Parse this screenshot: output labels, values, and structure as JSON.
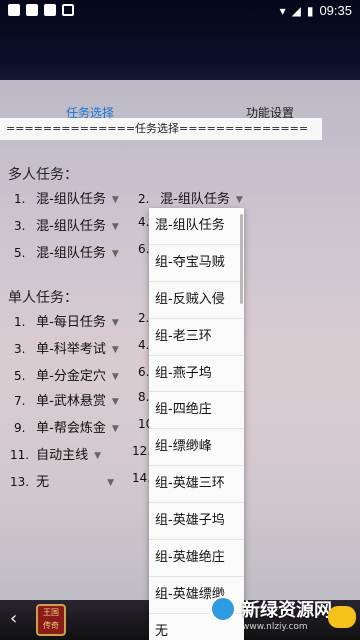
{
  "status_bar": {
    "time": "09:35",
    "left_icons": [
      "photo-icon",
      "square-icon",
      "square-icon",
      "apps-icon"
    ],
    "right_icons": [
      "wifi-icon",
      "signal-icon",
      "battery-icon"
    ]
  },
  "tabs": [
    "任务选择",
    "功能设置"
  ],
  "section_title": "==============任务选择==============",
  "multi": {
    "heading": "多人任务：",
    "rows": [
      {
        "num": "1.",
        "value": "混-组队任务"
      },
      {
        "num": "2.",
        "value": "混-组队任务"
      },
      {
        "num": "3.",
        "value": "混-组队任务"
      },
      {
        "num": "4.",
        "value": ""
      },
      {
        "num": "5.",
        "value": "混-组队任务"
      },
      {
        "num": "6.",
        "value": ""
      }
    ]
  },
  "single": {
    "heading": "单人任务：",
    "rows": [
      {
        "num": "1.",
        "value": "单-每日任务"
      },
      {
        "num": "2.",
        "value": ""
      },
      {
        "num": "3.",
        "value": "单-科举考试"
      },
      {
        "num": "4.",
        "value": ""
      },
      {
        "num": "5.",
        "value": "单-分金定穴"
      },
      {
        "num": "6.",
        "value": ""
      },
      {
        "num": "7.",
        "value": "单-武林悬赏"
      },
      {
        "num": "8.",
        "value": ""
      },
      {
        "num": "9.",
        "value": "单-帮会炼金"
      },
      {
        "num": "10.",
        "value": ""
      },
      {
        "num": "11.",
        "value": "自动主线"
      },
      {
        "num": "12.",
        "value": ""
      },
      {
        "num": "13.",
        "value": "无"
      },
      {
        "num": "14.",
        "value": ""
      }
    ]
  },
  "dropdown": {
    "options": [
      "混-组队任务",
      "组-夺宝马贼",
      "组-反贼入侵",
      "组-老三环",
      "组-燕子坞",
      "组-四绝庄",
      "组-缥缈峰",
      "组-英雄三环",
      "组-英雄子坞",
      "组-英雄绝庄",
      "组-英雄缥缈",
      "无"
    ]
  },
  "dock": {
    "app_icon_text": [
      "王国",
      "传奇"
    ]
  },
  "watermark": {
    "text": "新绿资源网",
    "url": "www.nlziy.com"
  }
}
